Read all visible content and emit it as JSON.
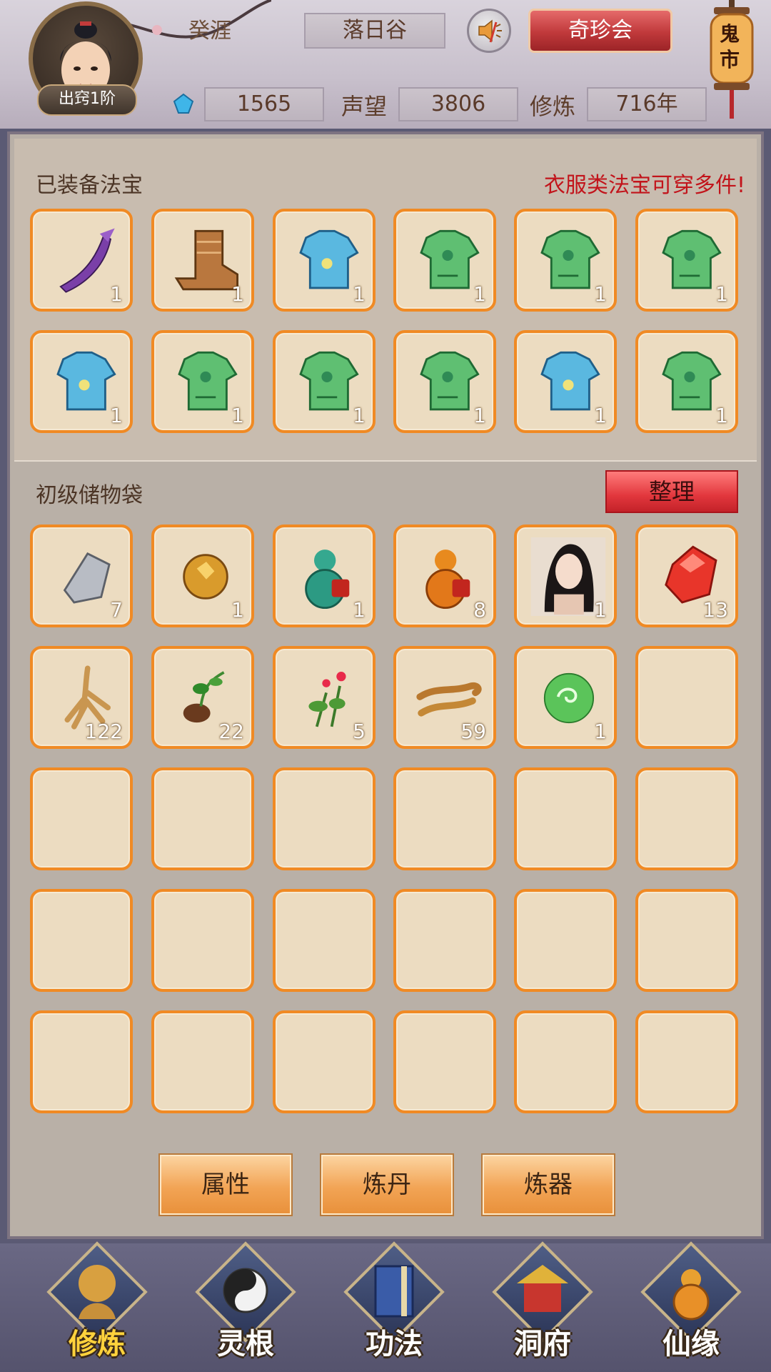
{
  "header": {
    "player_name": "癸涯",
    "rank_badge": "出窍1阶",
    "location": "落日谷",
    "qizhen_label": "奇珍会",
    "market_label": "鬼市",
    "spirit_stones": "1565",
    "reputation_label": "声望",
    "reputation": "3806",
    "cultivation_label": "修炼",
    "cultivation": "716年"
  },
  "equipped": {
    "title": "已装备法宝",
    "notice": "衣服类法宝可穿多件!",
    "items": [
      {
        "icon": "purple-blade-icon",
        "qty": "1"
      },
      {
        "icon": "boots-icon",
        "qty": "1"
      },
      {
        "icon": "blue-armor-icon",
        "qty": "1"
      },
      {
        "icon": "green-armor-icon",
        "qty": "1"
      },
      {
        "icon": "green-armor-icon",
        "qty": "1"
      },
      {
        "icon": "green-armor-icon",
        "qty": "1"
      },
      {
        "icon": "blue-armor-icon",
        "qty": "1"
      },
      {
        "icon": "green-armor-icon",
        "qty": "1"
      },
      {
        "icon": "green-armor-icon",
        "qty": "1"
      },
      {
        "icon": "green-armor-icon",
        "qty": "1"
      },
      {
        "icon": "blue-armor-icon",
        "qty": "1"
      },
      {
        "icon": "green-armor-icon",
        "qty": "1"
      }
    ]
  },
  "bag": {
    "title": "初级储物袋",
    "sort_label": "整理",
    "items": [
      {
        "icon": "silver-ore-icon",
        "qty": "7"
      },
      {
        "icon": "gold-ore-icon",
        "qty": "1"
      },
      {
        "icon": "green-gourd-icon",
        "qty": "1"
      },
      {
        "icon": "orange-gourd-icon",
        "qty": "8"
      },
      {
        "icon": "maiden-portrait-icon",
        "qty": "1"
      },
      {
        "icon": "red-crystal-icon",
        "qty": "13"
      },
      {
        "icon": "ginseng-icon",
        "qty": "122"
      },
      {
        "icon": "herb-root-icon",
        "qty": "22"
      },
      {
        "icon": "red-flower-herb-icon",
        "qty": "5"
      },
      {
        "icon": "cordyceps-icon",
        "qty": "59"
      },
      {
        "icon": "green-orb-icon",
        "qty": "1"
      }
    ],
    "total_slots": 30
  },
  "actions": {
    "attributes": "属性",
    "alchemy": "炼丹",
    "forging": "炼器"
  },
  "nav": [
    {
      "label": "修炼",
      "icon": "cultivate-icon",
      "active": true
    },
    {
      "label": "灵根",
      "icon": "spirit-root-icon",
      "active": false
    },
    {
      "label": "功法",
      "icon": "technique-book-icon",
      "active": false
    },
    {
      "label": "洞府",
      "icon": "cave-house-icon",
      "active": false
    },
    {
      "label": "仙缘",
      "icon": "fate-gourd-icon",
      "active": false
    }
  ]
}
